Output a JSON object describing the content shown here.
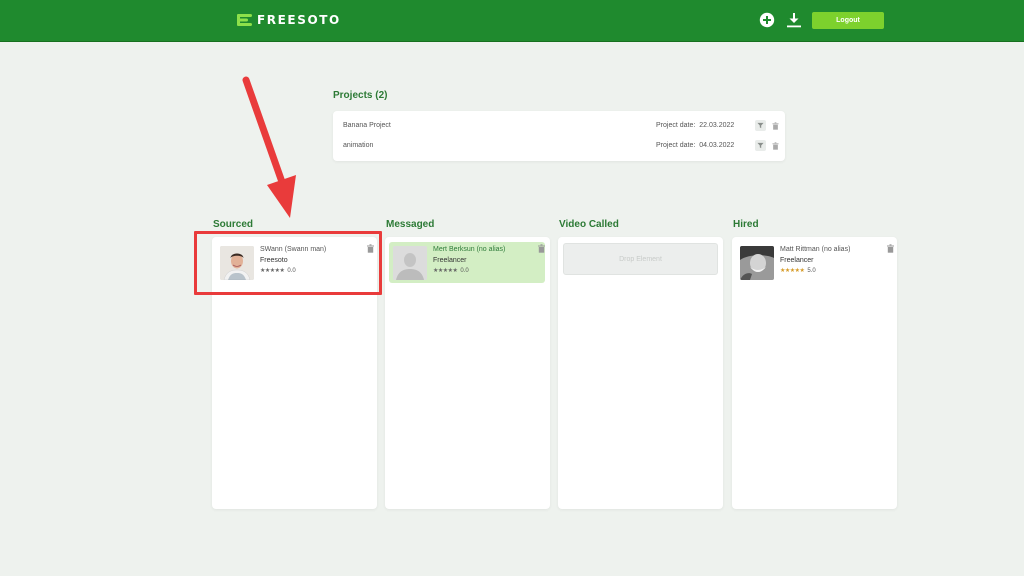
{
  "header": {
    "logo_text": "FREESOTO",
    "logout_label": "Logout",
    "icons": [
      "add-icon",
      "download-icon"
    ],
    "brand_color": "#1f8a2e",
    "accent_color": "#7dd12d"
  },
  "projects": {
    "title": "Projects (2)",
    "items": [
      {
        "name": "Banana Project",
        "date_label": "Project date:",
        "date": "22.03.2022"
      },
      {
        "name": "animation",
        "date_label": "Project date:",
        "date": "04.03.2022"
      }
    ]
  },
  "columns": [
    {
      "title": "Sourced",
      "candidate": {
        "name": "SWann (Swann man)",
        "role": "Freesoto",
        "rating": "0.0"
      }
    },
    {
      "title": "Messaged",
      "candidate": {
        "name": "Mert Berksun (no alias)",
        "role": "Freelancer",
        "rating": "0.0"
      }
    },
    {
      "title": "Video Called",
      "drop_text": "Drop Element"
    },
    {
      "title": "Hired",
      "candidate": {
        "name": "Matt Rittman (no alias)",
        "role": "Freelancer",
        "rating": "5.0"
      }
    }
  ],
  "annotation_color": "#e93b3b"
}
